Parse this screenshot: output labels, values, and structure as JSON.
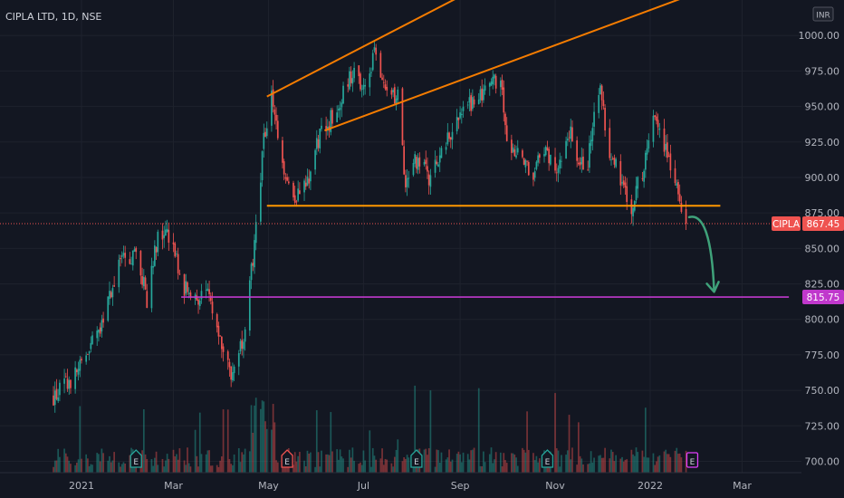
{
  "header": {
    "symbol_title": "CIPLA LTD, 1D, NSE",
    "currency": "INR"
  },
  "colors": {
    "background": "#131722",
    "up": "#26a69a",
    "down": "#ef5350",
    "trendline": "#f57c00",
    "support_line": "#ff9800",
    "target_line": "#c038cc",
    "arrow": "#3fa27a",
    "grid": "#1e222d"
  },
  "chart_data": {
    "type": "candlestick",
    "title": "CIPLA LTD, 1D, NSE",
    "x_ticks": [
      "2021",
      "Mar",
      "May",
      "Jul",
      "Sep",
      "Nov",
      "2022",
      "Mar"
    ],
    "y_ticks": [
      "700.00",
      "725.00",
      "750.00",
      "775.00",
      "800.00",
      "825.00",
      "850.00",
      "875.00",
      "900.00",
      "925.00",
      "950.00",
      "975.00",
      "1000.00"
    ],
    "ylim": [
      692,
      1025
    ],
    "last_price": {
      "symbol": "CIPLA",
      "value": "867.45",
      "price": 867.45
    },
    "target_price": {
      "value": "815.75",
      "price": 815.75
    },
    "support_level": 880,
    "anchors": [
      [
        "2020-12-14",
        745
      ],
      [
        "2020-12-28",
        760
      ],
      [
        "2021-01-12",
        790
      ],
      [
        "2021-01-25",
        840
      ],
      [
        "2021-02-05",
        845
      ],
      [
        "2021-02-12",
        815
      ],
      [
        "2021-02-19",
        860
      ],
      [
        "2021-02-26",
        860
      ],
      [
        "2021-03-08",
        822
      ],
      [
        "2021-03-15",
        815
      ],
      [
        "2021-03-25",
        815
      ],
      [
        "2021-04-07",
        760
      ],
      [
        "2021-04-15",
        790
      ],
      [
        "2021-04-22",
        850
      ],
      [
        "2021-04-28",
        925
      ],
      [
        "2021-05-03",
        955
      ],
      [
        "2021-05-10",
        910
      ],
      [
        "2021-05-17",
        885
      ],
      [
        "2021-05-26",
        898
      ],
      [
        "2021-06-03",
        930
      ],
      [
        "2021-06-14",
        948
      ],
      [
        "2021-06-25",
        978
      ],
      [
        "2021-07-01",
        960
      ],
      [
        "2021-07-08",
        988
      ],
      [
        "2021-07-14",
        960
      ],
      [
        "2021-07-23",
        958
      ],
      [
        "2021-07-28",
        890
      ],
      [
        "2021-08-03",
        910
      ],
      [
        "2021-08-13",
        900
      ],
      [
        "2021-08-23",
        925
      ],
      [
        "2021-09-01",
        945
      ],
      [
        "2021-09-10",
        955
      ],
      [
        "2021-09-20",
        960
      ],
      [
        "2021-09-27",
        975
      ],
      [
        "2021-10-01",
        925
      ],
      [
        "2021-10-08",
        915
      ],
      [
        "2021-10-18",
        905
      ],
      [
        "2021-10-26",
        918
      ],
      [
        "2021-11-01",
        905
      ],
      [
        "2021-11-10",
        935
      ],
      [
        "2021-11-15",
        910
      ],
      [
        "2021-11-22",
        910
      ],
      [
        "2021-11-29",
        965
      ],
      [
        "2021-12-06",
        918
      ],
      [
        "2021-12-15",
        895
      ],
      [
        "2021-12-20",
        880
      ],
      [
        "2021-12-27",
        905
      ],
      [
        "2022-01-03",
        945
      ],
      [
        "2022-01-10",
        925
      ],
      [
        "2022-01-17",
        900
      ],
      [
        "2022-01-24",
        867
      ]
    ],
    "annotations": {
      "upper_channel": [
        [
          "2021-04-30",
          957
        ],
        [
          "2021-11-06",
          1065
        ]
      ],
      "lower_channel": [
        [
          "2021-06-06",
          933
        ],
        [
          "2022-02-12",
          1035
        ]
      ],
      "support": [
        [
          "2021-04-30",
          880
        ],
        [
          "2022-02-15",
          880
        ]
      ],
      "target": [
        [
          "2021-03-06",
          815.75
        ],
        [
          "2022-03-31",
          815.75
        ]
      ],
      "arrow_path": [
        [
          "2022-01-26",
          872
        ],
        [
          "2022-02-02",
          862
        ],
        [
          "2022-02-11",
          820
        ]
      ]
    },
    "events": [
      {
        "label": "E",
        "date": "2021-02-05",
        "kind": "earnings",
        "color": "#26a69a"
      },
      {
        "label": "E",
        "date": "2021-05-13",
        "kind": "earnings",
        "color": "#ef5350"
      },
      {
        "label": "E",
        "date": "2021-08-04",
        "kind": "earnings",
        "color": "#26a69a"
      },
      {
        "label": "E",
        "date": "2021-10-27",
        "kind": "earnings",
        "color": "#26a69a"
      },
      {
        "label": "E",
        "date": "2022-01-28",
        "kind": "upcoming",
        "color": "#e040fb"
      }
    ],
    "volume": {
      "max_bar_height_ratio": 1.0
    }
  }
}
